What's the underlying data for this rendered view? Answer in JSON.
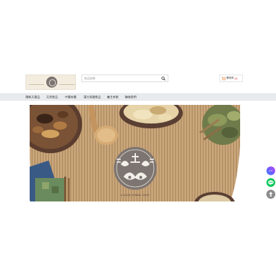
{
  "header": {
    "logo_alt": "善堂",
    "search": {
      "placeholder": "商品搜尋"
    },
    "cart": {
      "label": "購物車",
      "count": "(0)"
    }
  },
  "nav": {
    "items": [
      {
        "label": "爾新天產品"
      },
      {
        "label": "天然食品"
      },
      {
        "label": "中藥材藥"
      },
      {
        "label": "漢方保健食品"
      },
      {
        "label": "養生茶飲"
      },
      {
        "label": "聯絡我們"
      }
    ]
  },
  "hero": {
    "emblem_text": "善堂",
    "tagline": "A GOOD HERBAL SHOP"
  },
  "floating": {
    "messenger": "messenger-icon",
    "line": "line-icon",
    "back_to_top": "arrow-up-icon"
  },
  "colors": {
    "nav_bg": "#e8eaed",
    "wood": "#c7a47a",
    "emblem": "#7d7571",
    "messenger_gradient_start": "#2d7bff",
    "messenger_gradient_end": "#c03fff",
    "line_green": "#06c755"
  }
}
